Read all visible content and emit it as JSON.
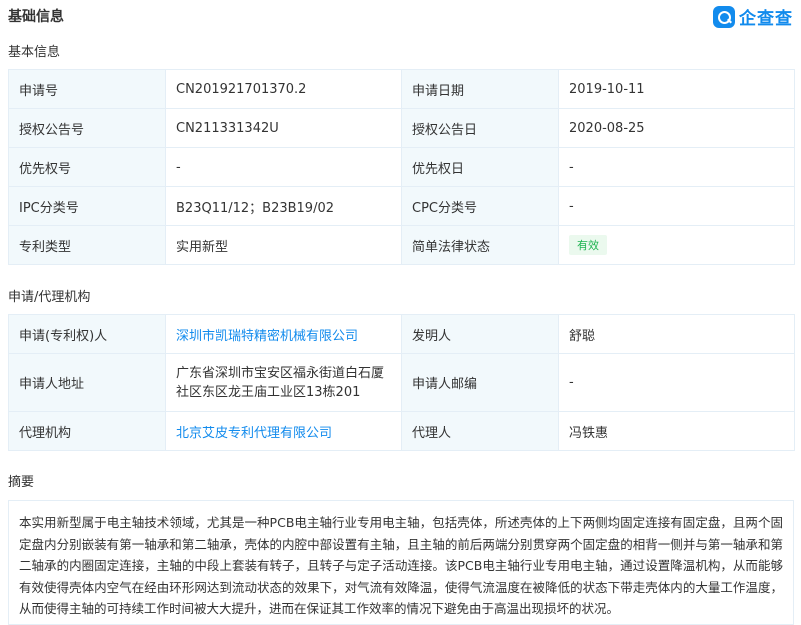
{
  "page_title": "基础信息",
  "logo_text": "企查查",
  "basic": {
    "title": "基本信息",
    "rows": [
      {
        "l1": "申请号",
        "v1": "CN201921701370.2",
        "l2": "申请日期",
        "v2": "2019-10-11"
      },
      {
        "l1": "授权公告号",
        "v1": "CN211331342U",
        "l2": "授权公告日",
        "v2": "2020-08-25"
      },
      {
        "l1": "优先权号",
        "v1": "-",
        "l2": "优先权日",
        "v2": "-"
      },
      {
        "l1": "IPC分类号",
        "v1": "B23Q11/12；B23B19/02",
        "l2": "CPC分类号",
        "v2": "-"
      },
      {
        "l1": "专利类型",
        "v1": "实用新型",
        "l2": "简单法律状态",
        "v2": "有效"
      }
    ]
  },
  "agency": {
    "title": "申请/代理机构",
    "rows": [
      {
        "l1": "申请(专利权)人",
        "v1": "深圳市凯瑞特精密机械有限公司",
        "l2": "发明人",
        "v2": "舒聪"
      },
      {
        "l1": "申请人地址",
        "v1": "广东省深圳市宝安区福永街道白石厦社区东区龙王庙工业区13栋201",
        "l2": "申请人邮编",
        "v2": "-"
      },
      {
        "l1": "代理机构",
        "v1": "北京艾皮专利代理有限公司",
        "l2": "代理人",
        "v2": "冯铁惠"
      }
    ]
  },
  "abstract": {
    "title": "摘要",
    "text": "本实用新型属于电主轴技术领域，尤其是一种PCB电主轴行业专用电主轴，包括壳体，所述壳体的上下两侧均固定连接有固定盘，且两个固定盘内分别嵌装有第一轴承和第二轴承，壳体的内腔中部设置有主轴，且主轴的前后两端分别贯穿两个固定盘的相背一侧并与第一轴承和第二轴承的内圈固定连接，主轴的中段上套装有转子，且转子与定子活动连接。该PCB电主轴行业专用电主轴，通过设置降温机构，从而能够有效使得壳体内空气在经由环形网达到流动状态的效果下，对气流有效降温，使得气流温度在被降低的状态下带走壳体内的大量工作温度，从而使得主轴的可持续工作时间被大大提升，进而在保证其工作效率的情况下避免由于高温出现损坏的状况。"
  },
  "colors": {
    "accent": "#128bed",
    "label_bg": "#f2f9fc",
    "border": "#e4eef6",
    "status_green": "#1eb450"
  }
}
